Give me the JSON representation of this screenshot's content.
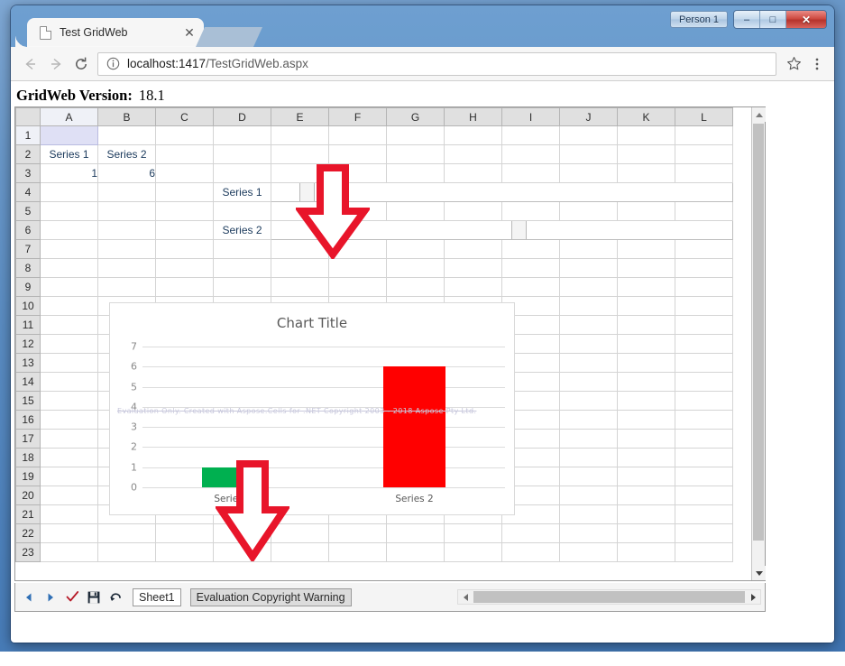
{
  "window": {
    "person_label": "Person 1",
    "minimize": "–",
    "maximize": "□",
    "close": "✕"
  },
  "browser": {
    "tab": {
      "title": "Test GridWeb",
      "close_label": "✕"
    },
    "nav": {
      "back": "←",
      "forward": "→",
      "reload": "⟳"
    },
    "omnibox": {
      "info_icon": "ⓘ",
      "host": "localhost:1417",
      "path": "/TestGridWeb.aspx"
    },
    "bookmark_icon": "☆",
    "menu_icon": "⋮"
  },
  "page": {
    "version_label": "GridWeb Version:",
    "version_value": "18.1"
  },
  "grid": {
    "columns": [
      "A",
      "B",
      "C",
      "D",
      "E",
      "F",
      "G",
      "H",
      "I",
      "J",
      "K",
      "L"
    ],
    "rows": [
      "1",
      "2",
      "3",
      "4",
      "5",
      "6",
      "7",
      "8",
      "9",
      "10",
      "11",
      "12",
      "13",
      "14",
      "15",
      "16",
      "17",
      "18",
      "19",
      "20",
      "21",
      "22",
      "23"
    ],
    "cells": {
      "A2": "Series 1",
      "B2": "Series 2",
      "A3": "1",
      "B3": "6",
      "D4": "Series 1",
      "D6": "Series 2"
    },
    "selected_cell": "A1"
  },
  "bottom_bar": {
    "prev_icon": "◀",
    "next_icon": "▶",
    "submit_icon": "✔",
    "save_icon": "save-icon",
    "undo_icon": "↶",
    "tabs": [
      {
        "label": "Sheet1",
        "active": true
      },
      {
        "label": "Evaluation Copyright Warning",
        "active": false
      }
    ]
  },
  "chart_data": {
    "type": "bar",
    "title": "Chart Title",
    "categories": [
      "Series 1",
      "Series 2"
    ],
    "values": [
      1,
      6
    ],
    "colors": [
      "#00b050",
      "#ff0000"
    ],
    "xlabel": "",
    "ylabel": "",
    "ylim": [
      0,
      7
    ],
    "yticks": [
      0,
      1,
      2,
      3,
      4,
      5,
      6,
      7
    ],
    "grid": true,
    "legend": "none",
    "watermark": "Evaluation Only. Created with Aspose.Cells for .NET Copyright 2003 - 2018 Aspose Pty Ltd."
  },
  "annotations": {
    "arrow_top_color": "#e8152a",
    "arrow_chart_color": "#e8152a"
  }
}
